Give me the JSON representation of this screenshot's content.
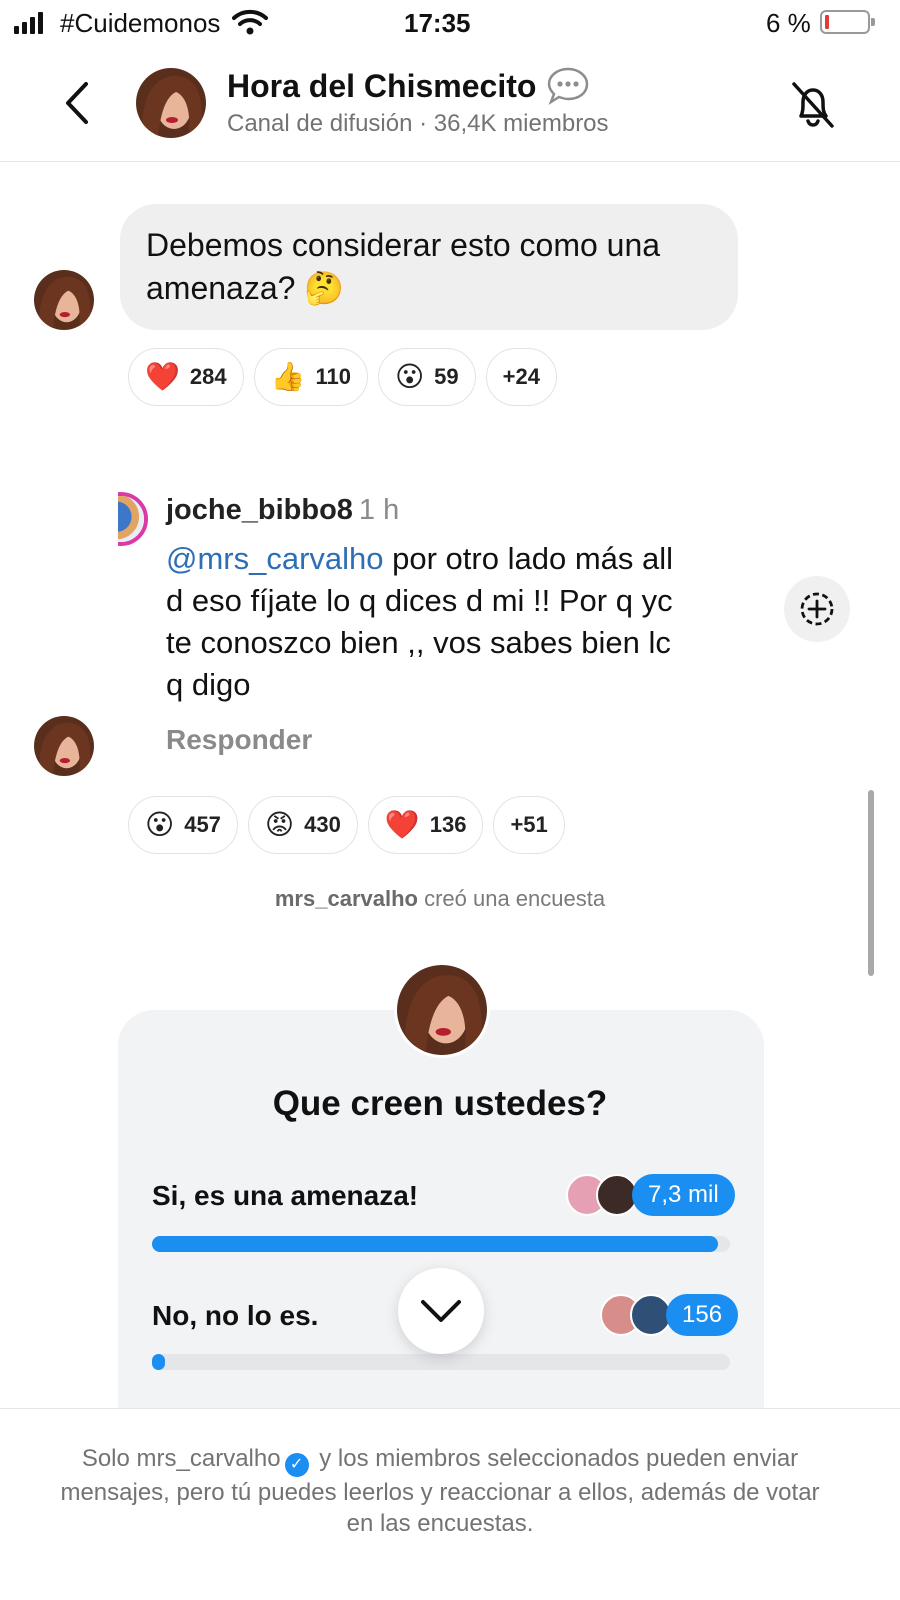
{
  "status_bar": {
    "carrier": "#Cuidemonos",
    "time": "17:35",
    "battery": "6 %"
  },
  "header": {
    "title": "Hora del Chismecito",
    "subtitle": "Canal de difusión · 36,4K miembros",
    "back_icon": "chevron-left-icon",
    "mute_icon": "bell-off-icon"
  },
  "message_1": {
    "text": "Debemos considerar esto como una amenaza?",
    "emoji": "🤔",
    "reactions": [
      {
        "emoji": "❤️",
        "count": "284"
      },
      {
        "emoji": "👍",
        "count": "110"
      },
      {
        "emoji": "😮",
        "count": "59"
      },
      {
        "more": "+24"
      }
    ]
  },
  "comment": {
    "username": "joche_bibbo8",
    "time": "1 h",
    "mention": "@mrs_carvalho",
    "text": " por otro lado más all\nd eso fíjate lo q dices d mi !! Por q yc\nte conoszco bien ,, vos sabes bien lc\nq digo",
    "reply": "Responder"
  },
  "message_2": {
    "reactions": [
      {
        "emoji": "😮",
        "count": "457"
      },
      {
        "emoji": "😡",
        "count": "430"
      },
      {
        "emoji": "❤️",
        "count": "136"
      },
      {
        "more": "+51"
      }
    ]
  },
  "system_message": {
    "user": "mrs_carvalho",
    "action": " creó una encuesta"
  },
  "poll": {
    "question": "Que creen ustedes?",
    "options": [
      {
        "label": "Si, es una amenaza!",
        "count": "7,3 mil",
        "fraction": 0.979
      },
      {
        "label": "No, no lo es.",
        "count": "156",
        "fraction": 0.021
      }
    ]
  },
  "footer": {
    "text_before": "Solo mrs_carvalho",
    "text_after": " y los miembros seleccionados pueden enviar mensajes, pero tú puedes leerlos y reaccionar a ellos, además de votar en las encuestas."
  },
  "colors": {
    "accent": "#1b8ef2",
    "bubble": "#efefef",
    "muted_text": "#737373",
    "story_ring": "#d93aa8"
  }
}
